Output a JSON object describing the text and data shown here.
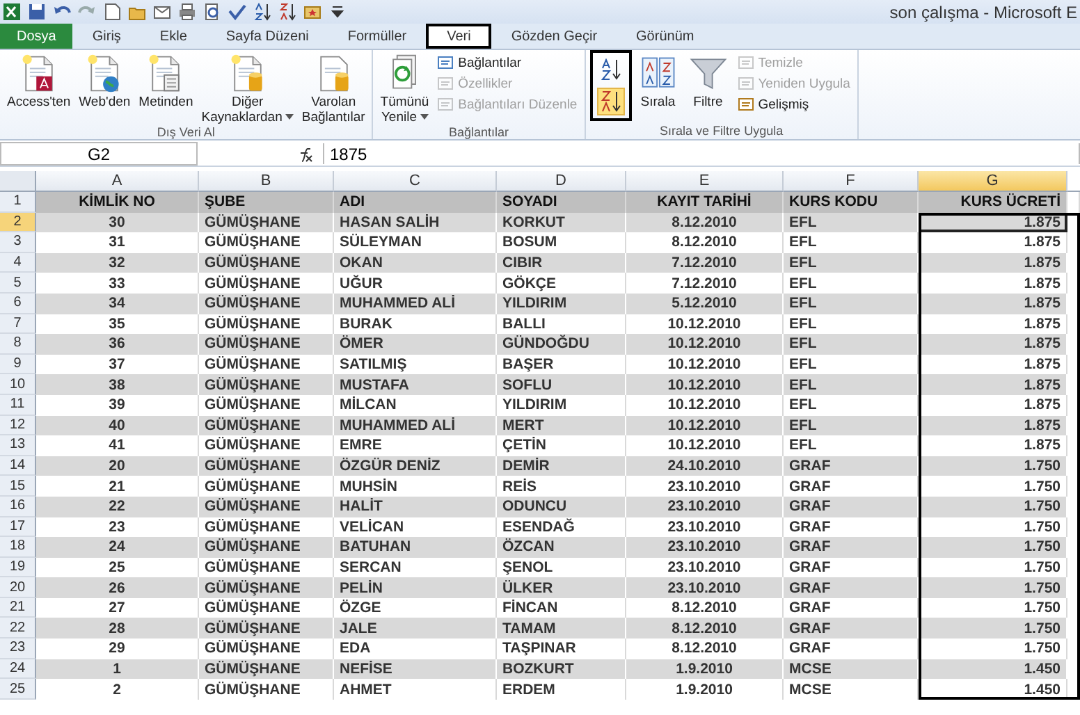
{
  "window": {
    "title": "son çalışma - Microsoft E"
  },
  "tabs": [
    {
      "label": "Dosya",
      "kind": "file",
      "selected": false,
      "annotated": false
    },
    {
      "label": "Giriş",
      "kind": "tab",
      "selected": false,
      "annotated": false
    },
    {
      "label": "Ekle",
      "kind": "tab",
      "selected": false,
      "annotated": false
    },
    {
      "label": "Sayfa Düzeni",
      "kind": "tab",
      "selected": false,
      "annotated": false
    },
    {
      "label": "Formüller",
      "kind": "tab",
      "selected": false,
      "annotated": false
    },
    {
      "label": "Veri",
      "kind": "tab",
      "selected": true,
      "annotated": true
    },
    {
      "label": "Gözden Geçir",
      "kind": "tab",
      "selected": false,
      "annotated": false
    },
    {
      "label": "Görünüm",
      "kind": "tab",
      "selected": false,
      "annotated": false
    }
  ],
  "ribbon": {
    "groups": [
      {
        "label": "Dış Veri Al",
        "items": [
          {
            "kind": "large",
            "label": "Access'ten",
            "dropdown": false
          },
          {
            "kind": "large",
            "label": "Web'den",
            "dropdown": false
          },
          {
            "kind": "large",
            "label": "Metinden",
            "dropdown": false
          },
          {
            "kind": "large",
            "label": "Diğer\nKaynaklardan",
            "dropdown": true
          },
          {
            "kind": "large",
            "label": "Varolan\nBağlantılar",
            "dropdown": false
          }
        ]
      },
      {
        "label": "Bağlantılar",
        "items": [
          {
            "kind": "large",
            "label": "Tümünü\nYenile",
            "dropdown": true
          },
          {
            "kind": "small",
            "label": "Bağlantılar",
            "disabled": false
          },
          {
            "kind": "small",
            "label": "Özellikler",
            "disabled": true
          },
          {
            "kind": "small",
            "label": "Bağlantıları Düzenle",
            "disabled": true
          }
        ]
      },
      {
        "label": "Sırala ve Filtre Uygula",
        "items": [
          {
            "kind": "sort_pair",
            "annotated": true
          },
          {
            "kind": "large",
            "label": "Sırala",
            "dropdown": false
          },
          {
            "kind": "large",
            "label": "Filtre",
            "dropdown": false
          },
          {
            "kind": "small",
            "label": "Temizle",
            "disabled": true
          },
          {
            "kind": "small",
            "label": "Yeniden Uygula",
            "disabled": true
          },
          {
            "kind": "small",
            "label": "Gelişmiş",
            "disabled": false
          }
        ]
      }
    ]
  },
  "formula_bar": {
    "name_box": "G2",
    "formula": "1875"
  },
  "sheet": {
    "columns": [
      {
        "letter": "A",
        "selected": false,
        "annotated": false
      },
      {
        "letter": "B",
        "selected": false,
        "annotated": false
      },
      {
        "letter": "C",
        "selected": false,
        "annotated": false
      },
      {
        "letter": "D",
        "selected": false,
        "annotated": false
      },
      {
        "letter": "E",
        "selected": false,
        "annotated": false
      },
      {
        "letter": "F",
        "selected": false,
        "annotated": false
      },
      {
        "letter": "G",
        "selected": true,
        "annotated": true
      }
    ],
    "rows": [
      {
        "number": "1",
        "selected": false,
        "cells": [
          "KİMLİK NO",
          "ŞUBE",
          "ADI",
          "SOYADI",
          "KAYIT TARİHİ",
          "KURS KODU",
          "KURS ÜCRETİ"
        ]
      },
      {
        "number": "2",
        "selected": true,
        "cells": [
          "30",
          "GÜMÜŞHANE",
          "HASAN SALİH",
          "KORKUT",
          "8.12.2010",
          "EFL",
          "1.875"
        ]
      },
      {
        "number": "3",
        "selected": false,
        "cells": [
          "31",
          "GÜMÜŞHANE",
          "SÜLEYMAN",
          "BOSUM",
          "8.12.2010",
          "EFL",
          "1.875"
        ]
      },
      {
        "number": "4",
        "selected": false,
        "cells": [
          "32",
          "GÜMÜŞHANE",
          "OKAN",
          "CIBIR",
          "7.12.2010",
          "EFL",
          "1.875"
        ]
      },
      {
        "number": "5",
        "selected": false,
        "cells": [
          "33",
          "GÜMÜŞHANE",
          "UĞUR",
          "GÖKÇE",
          "7.12.2010",
          "EFL",
          "1.875"
        ]
      },
      {
        "number": "6",
        "selected": false,
        "cells": [
          "34",
          "GÜMÜŞHANE",
          "MUHAMMED ALİ",
          "YILDIRIM",
          "5.12.2010",
          "EFL",
          "1.875"
        ]
      },
      {
        "number": "7",
        "selected": false,
        "cells": [
          "35",
          "GÜMÜŞHANE",
          "BURAK",
          "BALLI",
          "10.12.2010",
          "EFL",
          "1.875"
        ]
      },
      {
        "number": "8",
        "selected": false,
        "cells": [
          "36",
          "GÜMÜŞHANE",
          "ÖMER",
          "GÜNDOĞDU",
          "10.12.2010",
          "EFL",
          "1.875"
        ]
      },
      {
        "number": "9",
        "selected": false,
        "cells": [
          "37",
          "GÜMÜŞHANE",
          "SATILMIŞ",
          "BAŞER",
          "10.12.2010",
          "EFL",
          "1.875"
        ]
      },
      {
        "number": "10",
        "selected": false,
        "cells": [
          "38",
          "GÜMÜŞHANE",
          "MUSTAFA",
          "SOFLU",
          "10.12.2010",
          "EFL",
          "1.875"
        ]
      },
      {
        "number": "11",
        "selected": false,
        "cells": [
          "39",
          "GÜMÜŞHANE",
          "MİLCAN",
          "YILDIRIM",
          "10.12.2010",
          "EFL",
          "1.875"
        ]
      },
      {
        "number": "12",
        "selected": false,
        "cells": [
          "40",
          "GÜMÜŞHANE",
          "MUHAMMED ALİ",
          "MERT",
          "10.12.2010",
          "EFL",
          "1.875"
        ]
      },
      {
        "number": "13",
        "selected": false,
        "cells": [
          "41",
          "GÜMÜŞHANE",
          "EMRE",
          "ÇETİN",
          "10.12.2010",
          "EFL",
          "1.875"
        ]
      },
      {
        "number": "14",
        "selected": false,
        "cells": [
          "20",
          "GÜMÜŞHANE",
          "ÖZGÜR DENİZ",
          "DEMİR",
          "24.10.2010",
          "GRAF",
          "1.750"
        ]
      },
      {
        "number": "15",
        "selected": false,
        "cells": [
          "21",
          "GÜMÜŞHANE",
          "MUHSİN",
          "REİS",
          "23.10.2010",
          "GRAF",
          "1.750"
        ]
      },
      {
        "number": "16",
        "selected": false,
        "cells": [
          "22",
          "GÜMÜŞHANE",
          "HALİT",
          "ODUNCU",
          "23.10.2010",
          "GRAF",
          "1.750"
        ]
      },
      {
        "number": "17",
        "selected": false,
        "cells": [
          "23",
          "GÜMÜŞHANE",
          "VELİCAN",
          "ESENDAĞ",
          "23.10.2010",
          "GRAF",
          "1.750"
        ]
      },
      {
        "number": "18",
        "selected": false,
        "cells": [
          "24",
          "GÜMÜŞHANE",
          "BATUHAN",
          "ÖZCAN",
          "23.10.2010",
          "GRAF",
          "1.750"
        ]
      },
      {
        "number": "19",
        "selected": false,
        "cells": [
          "25",
          "GÜMÜŞHANE",
          "SERCAN",
          "ŞENOL",
          "23.10.2010",
          "GRAF",
          "1.750"
        ]
      },
      {
        "number": "20",
        "selected": false,
        "cells": [
          "26",
          "GÜMÜŞHANE",
          "PELİN",
          "ÜLKER",
          "23.10.2010",
          "GRAF",
          "1.750"
        ]
      },
      {
        "number": "21",
        "selected": false,
        "cells": [
          "27",
          "GÜMÜŞHANE",
          "ÖZGE",
          "FİNCAN",
          "8.12.2010",
          "GRAF",
          "1.750"
        ]
      },
      {
        "number": "22",
        "selected": false,
        "cells": [
          "28",
          "GÜMÜŞHANE",
          "JALE",
          "TAMAM",
          "8.12.2010",
          "GRAF",
          "1.750"
        ]
      },
      {
        "number": "23",
        "selected": false,
        "cells": [
          "29",
          "GÜMÜŞHANE",
          "EDA",
          "TAŞPINAR",
          "8.12.2010",
          "GRAF",
          "1.750"
        ]
      },
      {
        "number": "24",
        "selected": false,
        "cells": [
          "1",
          "GÜMÜŞHANE",
          "NEFİSE",
          "BOZKURT",
          "1.9.2010",
          "MCSE",
          "1.450"
        ]
      },
      {
        "number": "25",
        "selected": false,
        "cells": [
          "2",
          "GÜMÜŞHANE",
          "AHMET",
          "ERDEM",
          "1.9.2010",
          "MCSE",
          "1.450"
        ]
      }
    ]
  }
}
